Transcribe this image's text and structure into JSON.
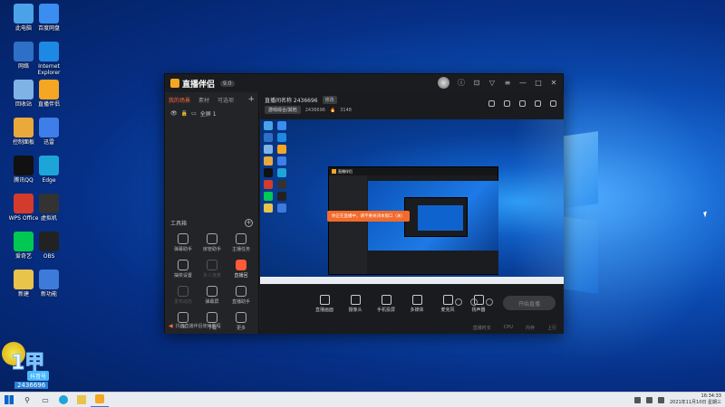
{
  "desktop": {
    "icons": [
      {
        "label": "此电脑",
        "color": "#4aa3e8"
      },
      {
        "label": "百度网盘",
        "color": "#3b8df0"
      },
      {
        "label": "网络",
        "color": "#2e6fc7"
      },
      {
        "label": "Internet Explorer",
        "color": "#1e88e5"
      },
      {
        "label": "回收站",
        "color": "#7fb3e6"
      },
      {
        "label": "直播伴侣",
        "color": "#f5a623"
      },
      {
        "label": "控制面板",
        "color": "#e9a93b"
      },
      {
        "label": "迅雷",
        "color": "#3f7ee8"
      },
      {
        "label": "腾讯QQ",
        "color": "#111111"
      },
      {
        "label": "Edge",
        "color": "#1ea5d8"
      },
      {
        "label": "WPS Office",
        "color": "#d33b2c"
      },
      {
        "label": "虚拟机",
        "color": "#333333"
      },
      {
        "label": "爱奇艺",
        "color": "#00c853"
      },
      {
        "label": "OBS",
        "color": "#222222"
      },
      {
        "label": "新建",
        "color": "#e8c44a"
      },
      {
        "label": "新功能",
        "color": "#3e7ad9"
      }
    ]
  },
  "app": {
    "name": "直播伴侣",
    "version": "9.0",
    "tabs": [
      "我的场景",
      "素材",
      "可选项"
    ],
    "active_tab": "我的场景",
    "scene": "全屏 1",
    "tools_title": "工具箱",
    "tools": [
      {
        "label": "弹幕助手",
        "state": "normal"
      },
      {
        "label": "房管助手",
        "state": "normal"
      },
      {
        "label": "主播任务",
        "state": "normal"
      },
      {
        "label": "抽奖设置",
        "state": "normal"
      },
      {
        "label": "多人连麦",
        "state": "dim"
      },
      {
        "label": "直播回",
        "state": "hot"
      },
      {
        "label": "发布动态",
        "state": "dim"
      },
      {
        "label": "弹幕屏",
        "state": "normal"
      },
      {
        "label": "直播助手",
        "state": "normal"
      },
      {
        "label": "PK",
        "state": "normal"
      },
      {
        "label": "下载",
        "state": "normal"
      },
      {
        "label": "更多",
        "state": "normal"
      }
    ],
    "notice": "抖音直播伴侣使用教程",
    "room_title": "直播间名称 2436696",
    "edit_label": "修改",
    "category": "游戏综合/其他",
    "room_id": "2436696",
    "fans": "3148",
    "controls": [
      "直播画面",
      "摄像头",
      "手机投屏",
      "多媒体",
      "麦克风",
      "扬声器"
    ],
    "live_button": "开始直播",
    "status": [
      "直播时长",
      "CPU",
      "内存",
      "上行"
    ],
    "toast": "你正在直播中，请不要关闭本窗口（关）"
  },
  "overlay": {
    "big": "1甲",
    "tag": "抖音号",
    "number": "2436696"
  },
  "taskbar": {
    "time": "16:34:33",
    "date": "2021年11月10日 星期三"
  }
}
